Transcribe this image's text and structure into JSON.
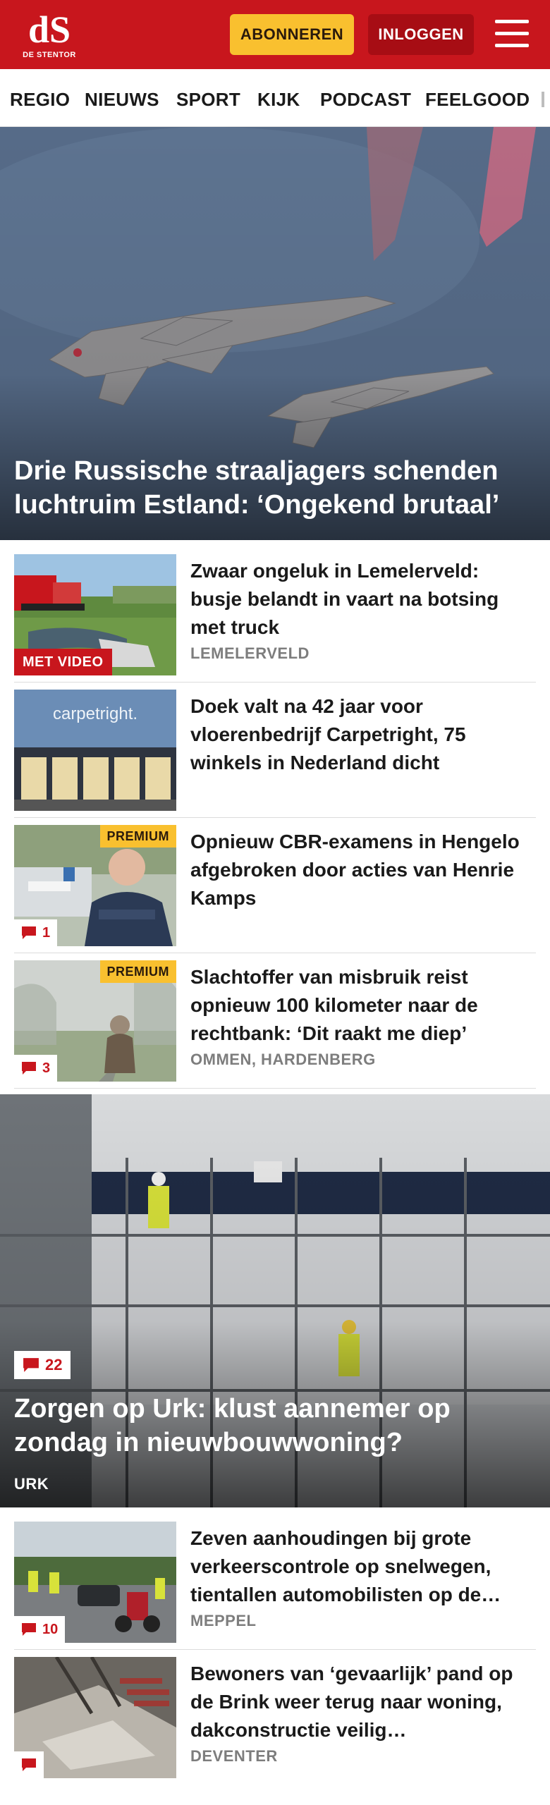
{
  "header": {
    "logo_mark": "dS",
    "logo_text": "DE STENTOR",
    "subscribe_label": "ABONNEREN",
    "login_label": "INLOGGEN",
    "menu_icon": "hamburger-menu-icon",
    "brand_color": "#c8161d",
    "accent_color": "#f9c02f"
  },
  "nav": {
    "items": [
      "REGIO",
      "NIEUWS",
      "SPORT",
      "KIJK",
      "PODCAST",
      "FEELGOOD"
    ]
  },
  "hero": {
    "title": "Drie Russische straaljagers schenden luchtruim Estland: ‘Ongekend brutaal’"
  },
  "articles": [
    {
      "title": "Zwaar ongeluk in Lemelerveld: busje belandt in vaart na botsing met truck",
      "tag": "LEMELERVELD",
      "label": "MET VIDEO"
    },
    {
      "title": "Doek valt na 42 jaar voor vloerenbedrijf Carpetright, 75 winkels in Nederland dicht",
      "thumb_text": "carpetright."
    },
    {
      "title": "Opnieuw CBR-examens in Hengelo afgebroken door acties van Henrie Kamps",
      "premium": "PREMIUM",
      "comments": "1"
    },
    {
      "title": "Slachtoffer van misbruik reist opnieuw 100 kilometer naar de rechtbank: ‘Dit raakt me diep’",
      "tag": "OMMEN, HARDENBERG",
      "premium": "PREMIUM",
      "comments": "3"
    }
  ],
  "feature": {
    "title": "Zorgen op Urk: klust aannemer op zondag in nieuwbouwwoning?",
    "tag": "URK",
    "comments": "22"
  },
  "articles_bottom": [
    {
      "title": "Zeven aanhoudingen bij grote verkeerscontrole op snelwegen, tientallen automobilisten op de…",
      "tag": "MEPPEL",
      "comments": "10"
    },
    {
      "title": "Bewoners van ‘gevaarlijk’ pand op de Brink weer terug naar woning, dakconstructie veilig…",
      "tag": "DEVENTER",
      "comments": ""
    }
  ]
}
